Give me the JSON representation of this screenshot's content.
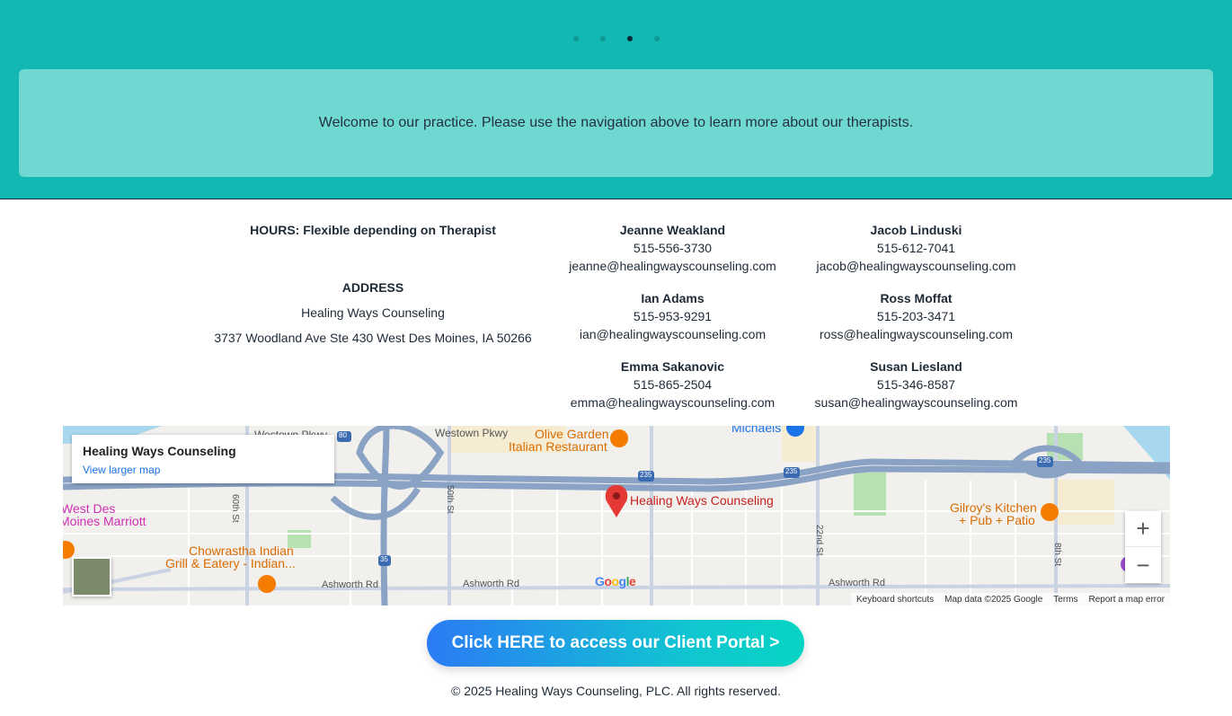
{
  "carousel": {
    "slide_count": 4,
    "active_index": 2
  },
  "welcome": {
    "text": "Welcome to our practice. Please use the navigation above to learn more about our therapists."
  },
  "info": {
    "hours": "HOURS: Flexible depending on Therapist",
    "address_title": "ADDRESS",
    "address_name": "Healing Ways Counseling",
    "address_line": "3737 Woodland Ave Ste 430 West Des Moines, IA 50266"
  },
  "therapists": [
    {
      "name": "Jeanne Weakland",
      "phone": "515-556-3730",
      "email": "jeanne@healingwayscounseling.com"
    },
    {
      "name": "Jacob Linduski",
      "phone": "515-612-7041",
      "email": "jacob@healingwayscounseling.com"
    },
    {
      "name": "Ian Adams",
      "phone": "515-953-9291",
      "email": "ian@healingwayscounseling.com"
    },
    {
      "name": "Ross Moffat",
      "phone": "515-203-3471",
      "email": "ross@healingwayscounseling.com"
    },
    {
      "name": "Emma Sakanovic",
      "phone": "515-865-2504",
      "email": "emma@healingwayscounseling.com"
    },
    {
      "name": "Susan Liesland",
      "phone": "515-346-8587",
      "email": "susan@healingwayscounseling.com"
    }
  ],
  "map": {
    "place_title": "Healing Ways Counseling",
    "view_larger": "View larger map",
    "pin_label": "Healing Ways Counseling",
    "zoom_in": "+",
    "zoom_out": "−",
    "attribution": {
      "shortcuts": "Keyboard shortcuts",
      "data": "Map data ©2025 Google",
      "terms": "Terms",
      "report": "Report a map error"
    },
    "labels": {
      "westown": "Westown Pkwy",
      "olive1": "Olive Garden",
      "olive2": "Italian Restaurant",
      "michaels": "Michaels",
      "marriott1": "West Des",
      "marriott2": "Moines Marriott",
      "chow1": "Chowrastha Indian",
      "chow2": "Grill & Eatery - Indian...",
      "gilroy1": "Gilroy's Kitchen",
      "gilroy2": "+ Pub + Patio",
      "ashworth1": "Ashworth Rd",
      "ashworth2": "Ashworth Rd",
      "ashworth3": "Ashworth Rd",
      "st60": "60th St",
      "st50": "50th St",
      "st22": "22nd St",
      "st8": "8th St",
      "i80": "80",
      "i235a": "235",
      "i235b": "235",
      "i235c": "235",
      "i35": "35"
    },
    "colors": {
      "road": "#8aa2c4",
      "pin": "#e53935",
      "poi": "#f57c00",
      "park": "#b7e0b3"
    }
  },
  "portal_button": "Click HERE to access our Client Portal >",
  "footer": "© 2025 Healing Ways Counseling, PLC. All rights reserved.",
  "colors": {
    "hero": "#13b8b3",
    "welcome_box": "#6fd9d1",
    "accent_start": "#2b7bf5",
    "accent_end": "#08d4c4"
  }
}
